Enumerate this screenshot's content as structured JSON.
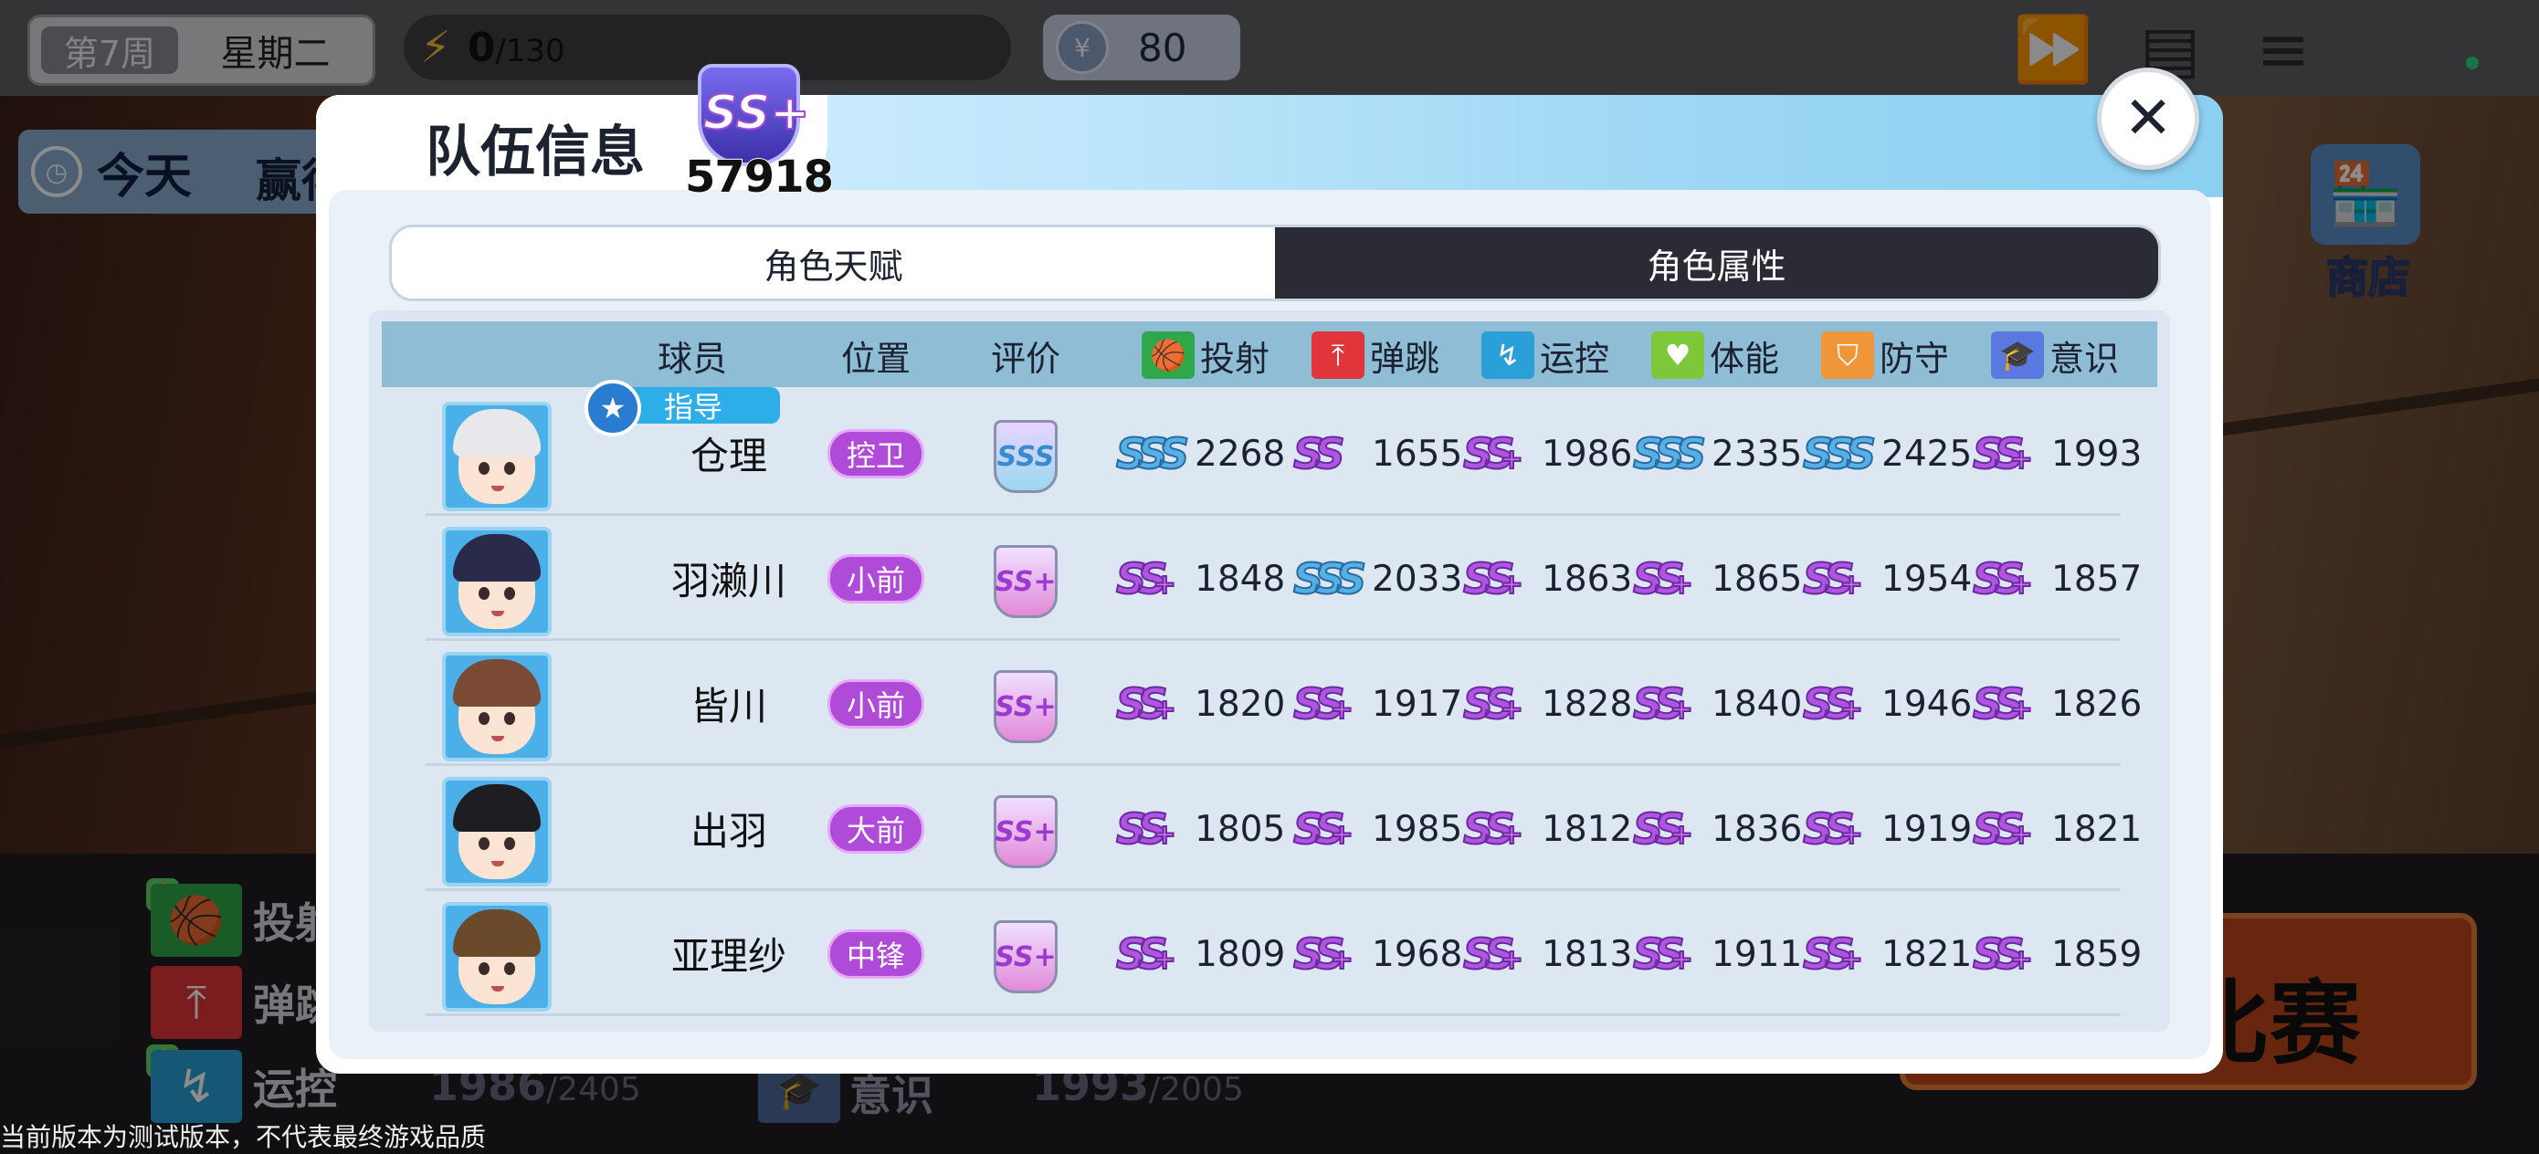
{
  "hud": {
    "week_tag": "第7周",
    "weekday": "星期二",
    "energy_current": "0",
    "energy_max": "/130",
    "coins": "80",
    "today_label": "今天",
    "today_extra": "赢得",
    "shop_label": "商店",
    "match_label": "比赛"
  },
  "background_stats": {
    "shoot_label": "投射",
    "jump_label": "弹跳",
    "dribble_label": "运控",
    "dribble_value": "1986",
    "dribble_max": "/2405",
    "awareness_label": "意识",
    "awareness_value": "1993",
    "awareness_max": "/2005"
  },
  "footer_notice": "当前版本为测试版本，不代表最终游戏品质",
  "dialog": {
    "title": "队伍信息",
    "power_grade": "SS+",
    "power_value": "57918",
    "tabs": [
      {
        "label": "角色天赋",
        "active": false
      },
      {
        "label": "角色属性",
        "active": true
      }
    ],
    "headers": {
      "player": "球员",
      "position": "位置",
      "rating": "评价",
      "stats": [
        {
          "label": "投射",
          "icon": "basketball-shoot-icon",
          "color": "#2ea84a"
        },
        {
          "label": "弹跳",
          "icon": "jump-icon",
          "color": "#e0353a"
        },
        {
          "label": "运控",
          "icon": "dribble-icon",
          "color": "#2a9fd8"
        },
        {
          "label": "体能",
          "icon": "heart-icon",
          "color": "#7cc83a"
        },
        {
          "label": "防守",
          "icon": "shield-icon",
          "color": "#f0963a"
        },
        {
          "label": "意识",
          "icon": "graduation-cap-icon",
          "color": "#5a78e0"
        }
      ]
    },
    "coach_badge": "指导",
    "players": [
      {
        "name": "仓理",
        "position": "控卫",
        "rating": "SSS",
        "is_coach": true,
        "hair_color": "#e8e8ec",
        "stats": [
          {
            "rank": "SSS",
            "value": "2268"
          },
          {
            "rank": "SS",
            "value": "1655"
          },
          {
            "rank": "SS+",
            "value": "1986"
          },
          {
            "rank": "SSS",
            "value": "2335"
          },
          {
            "rank": "SSS",
            "value": "2425"
          },
          {
            "rank": "SS+",
            "value": "1993"
          }
        ]
      },
      {
        "name": "羽濑川",
        "position": "小前",
        "rating": "SS+",
        "is_coach": false,
        "hair_color": "#2a2a4a",
        "stats": [
          {
            "rank": "SS+",
            "value": "1848"
          },
          {
            "rank": "SSS",
            "value": "2033"
          },
          {
            "rank": "SS+",
            "value": "1863"
          },
          {
            "rank": "SS+",
            "value": "1865"
          },
          {
            "rank": "SS+",
            "value": "1954"
          },
          {
            "rank": "SS+",
            "value": "1857"
          }
        ]
      },
      {
        "name": "皆川",
        "position": "小前",
        "rating": "SS+",
        "is_coach": false,
        "hair_color": "#7a4a34",
        "stats": [
          {
            "rank": "SS+",
            "value": "1820"
          },
          {
            "rank": "SS+",
            "value": "1917"
          },
          {
            "rank": "SS+",
            "value": "1828"
          },
          {
            "rank": "SS+",
            "value": "1840"
          },
          {
            "rank": "SS+",
            "value": "1946"
          },
          {
            "rank": "SS+",
            "value": "1826"
          }
        ]
      },
      {
        "name": "出羽",
        "position": "大前",
        "rating": "SS+",
        "is_coach": false,
        "hair_color": "#1e1e22",
        "stats": [
          {
            "rank": "SS+",
            "value": "1805"
          },
          {
            "rank": "SS+",
            "value": "1985"
          },
          {
            "rank": "SS+",
            "value": "1812"
          },
          {
            "rank": "SS+",
            "value": "1836"
          },
          {
            "rank": "SS+",
            "value": "1919"
          },
          {
            "rank": "SS+",
            "value": "1821"
          }
        ]
      },
      {
        "name": "亚理纱",
        "position": "中锋",
        "rating": "SS+",
        "is_coach": false,
        "hair_color": "#6a4a2a",
        "stats": [
          {
            "rank": "SS+",
            "value": "1809"
          },
          {
            "rank": "SS+",
            "value": "1968"
          },
          {
            "rank": "SS+",
            "value": "1813"
          },
          {
            "rank": "SS+",
            "value": "1911"
          },
          {
            "rank": "SS+",
            "value": "1821"
          },
          {
            "rank": "SS+",
            "value": "1859"
          }
        ]
      }
    ]
  },
  "icons": {
    "energy": "lightning-icon",
    "coin": "currency-coin-icon",
    "speed": "fast-forward-2x-icon",
    "tasks": "clipboard-icon",
    "menu": "hamburger-menu-icon",
    "close": "close-icon",
    "clock": "clock-icon",
    "shop": "shop-icon"
  }
}
